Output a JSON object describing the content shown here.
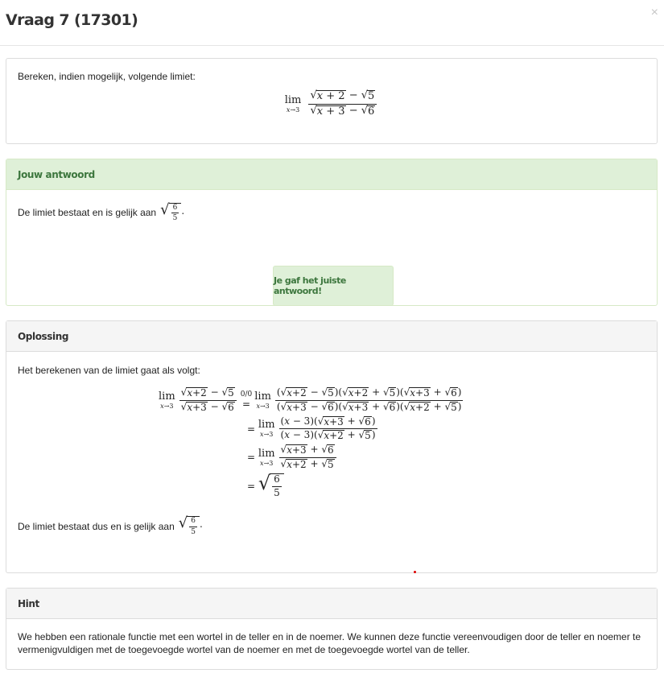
{
  "modal": {
    "title": "Vraag 7 (17301)",
    "close_symbol": "×"
  },
  "question": {
    "text": "Bereken, indien mogelijk, volgende limiet:",
    "formula": "lim_{x→3} (√(x+2) − √5) / (√(x+3) − √6)"
  },
  "answer": {
    "heading": "Jouw antwoord",
    "text": "De limiet bestaat en is gelijk aan",
    "value": "√(6/5)",
    "feedback": "Je gaf het juiste antwoord!"
  },
  "solution": {
    "heading": "Oplossing",
    "intro": "Het berekenen van de limiet gaat als volgt:",
    "indeterminate": "0/0",
    "conclusion": "De limiet bestaat dus en is gelijk aan"
  },
  "hint": {
    "heading": "Hint",
    "text": "We hebben een rationale functie met een wortel in de teller en in de noemer. We kunnen deze functie vereenvoudigen door de teller en noemer te vermenigvuldigen met de toegevoegde wortel van de noemer en met de toegevoegde wortel van de teller."
  },
  "colors": {
    "success_bg": "#dff0d8",
    "success_text": "#3c763d",
    "panel_heading": "#f5f5f5",
    "border": "#dcdcdc"
  }
}
